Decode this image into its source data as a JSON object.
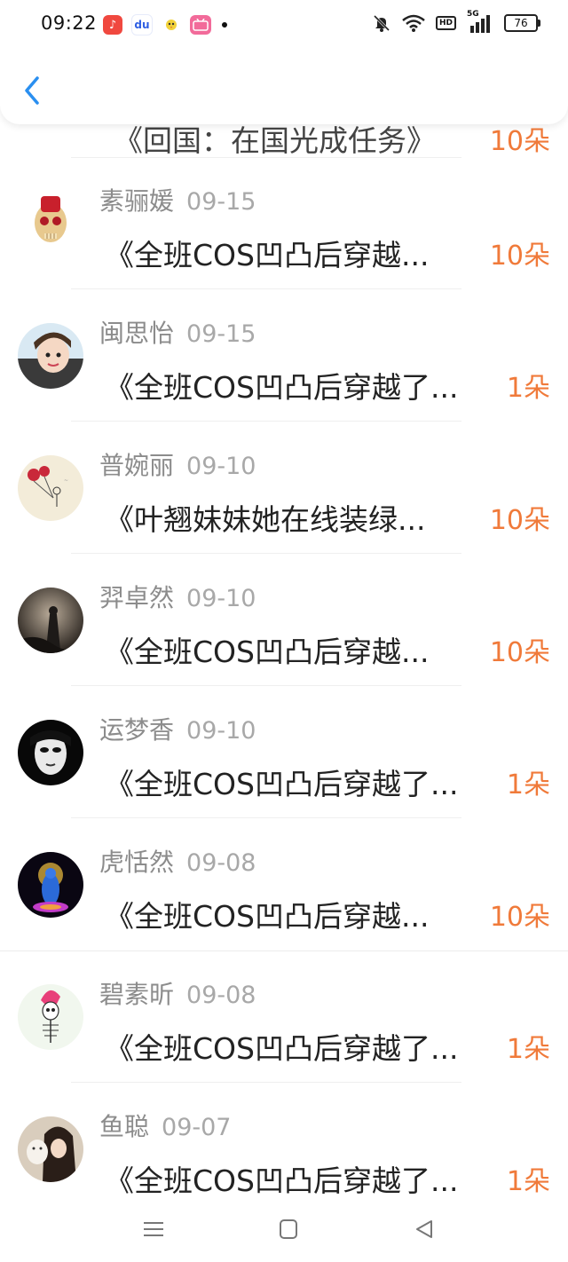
{
  "status_bar": {
    "time": "09:22",
    "battery": "76",
    "hd": "HD",
    "signal_label": "5G"
  },
  "app_icons": [
    "music-app-icon",
    "baidu-app-icon",
    "bird-app-icon",
    "bilibili-app-icon"
  ],
  "header": {
    "back_icon": "chevron-left-icon"
  },
  "partial_row": {
    "title": "《回国：在国光成任务》",
    "flowers": "10朵"
  },
  "rows": [
    {
      "name": "素骊媛",
      "date": "09-15",
      "title": "《全班COS凹凸后穿越...",
      "flowers": "10朵"
    },
    {
      "name": "闽思怡",
      "date": "09-15",
      "title": "《全班COS凹凸后穿越了...",
      "flowers": "1朵"
    },
    {
      "name": "普婉丽",
      "date": "09-10",
      "title": "《叶翘妹妹她在线装绿...",
      "flowers": "10朵"
    },
    {
      "name": "羿卓然",
      "date": "09-10",
      "title": "《全班COS凹凸后穿越...",
      "flowers": "10朵"
    },
    {
      "name": "运梦香",
      "date": "09-10",
      "title": "《全班COS凹凸后穿越了...",
      "flowers": "1朵"
    },
    {
      "name": "虎恬然",
      "date": "09-08",
      "title": "《全班COS凹凸后穿越...",
      "flowers": "10朵"
    },
    {
      "name": "碧素昕",
      "date": "09-08",
      "title": "《全班COS凹凸后穿越了...",
      "flowers": "1朵"
    },
    {
      "name": "鱼聪",
      "date": "09-07",
      "title": "《全班COS凹凸后穿越了...",
      "flowers": "1朵"
    }
  ],
  "colors": {
    "accent_orange": "#f07a3a",
    "back_blue": "#2a8ff0",
    "name_gray": "#8c8c8c",
    "title_dark": "#222222"
  },
  "nav": [
    "menu-icon",
    "home-square-icon",
    "back-triangle-icon"
  ]
}
